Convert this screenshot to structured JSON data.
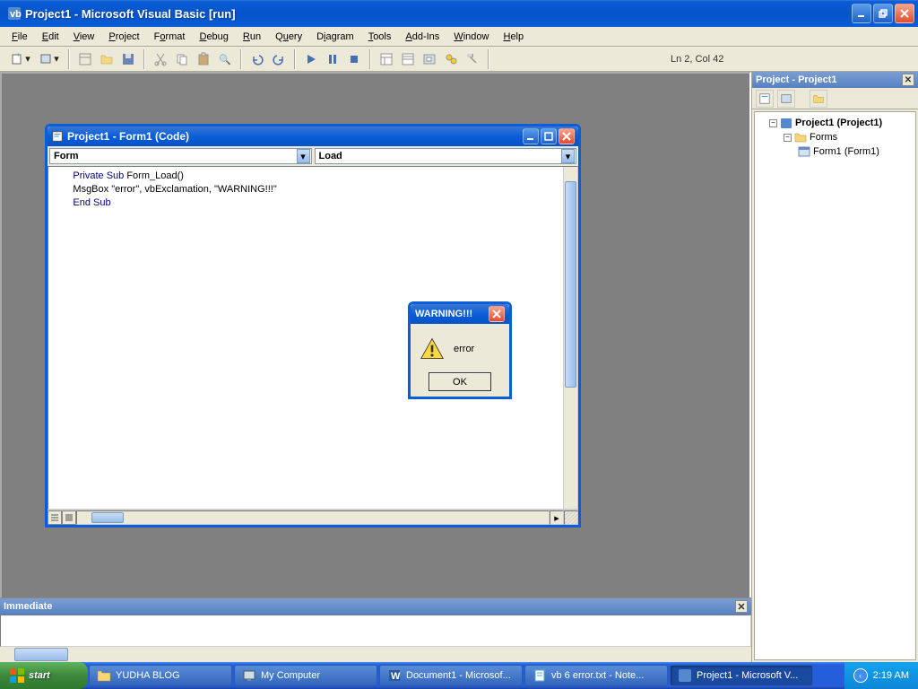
{
  "app": {
    "title": "Project1 - Microsoft Visual Basic [run]"
  },
  "menu": {
    "file": "File",
    "edit": "Edit",
    "view": "View",
    "project": "Project",
    "format": "Format",
    "debug": "Debug",
    "run": "Run",
    "query": "Query",
    "diagram": "Diagram",
    "tools": "Tools",
    "addins": "Add-Ins",
    "window": "Window",
    "help": "Help"
  },
  "status": {
    "cursor": "Ln 2, Col 42"
  },
  "project_panel": {
    "title": "Project - Project1",
    "root": "Project1 (Project1)",
    "forms_folder": "Forms",
    "form1": "Form1 (Form1)"
  },
  "code_window": {
    "title": "Project1 - Form1 (Code)",
    "object_dd": "Form",
    "proc_dd": "Load",
    "line1_a": "Private Sub",
    "line1_b": " Form_Load()",
    "line2": "MsgBox \"error\", vbExclamation, \"WARNING!!!\"",
    "line3": "End Sub"
  },
  "immediate": {
    "title": "Immediate"
  },
  "msgbox": {
    "title": "WARNING!!!",
    "text": "error",
    "ok": "OK"
  },
  "taskbar": {
    "start": "start",
    "items": [
      "YUDHA BLOG",
      "My Computer",
      "Document1 - Microsof...",
      "vb 6 error.txt - Note...",
      "Project1 - Microsoft V..."
    ],
    "time": "2:19 AM"
  }
}
